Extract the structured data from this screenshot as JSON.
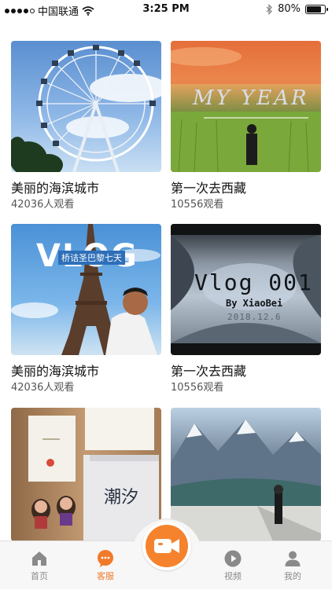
{
  "status_bar": {
    "carrier": "中国联通",
    "time": "3:25 PM",
    "battery_text": "80%",
    "battery_level": 0.8
  },
  "cards": [
    {
      "title": "美丽的海滨城市",
      "views": "42036人观看",
      "thumb_icon": "ferris-wheel-thumbnail"
    },
    {
      "title": "第一次去西藏",
      "views": "10556观看",
      "thumb_icon": "my-year-thumbnail",
      "overlay": "MY YEAR"
    },
    {
      "title": "美丽的海滨城市",
      "views": "42036人观看",
      "thumb_icon": "eiffel-tower-thumbnail",
      "overlay": "VLOG",
      "overlay_sub": "桥诘圣巴黎七天"
    },
    {
      "title": "第一次去西藏",
      "views": "10556观看",
      "thumb_icon": "vlog-001-thumbnail",
      "overlay": "Vlog 001",
      "overlay_by": "By XiaoBei",
      "overlay_date": "2018.12.6"
    },
    {
      "title": "",
      "views": "",
      "thumb_icon": "stationery-thumbnail",
      "overlay": "潮汐"
    },
    {
      "title": "",
      "views": "",
      "thumb_icon": "snow-mountain-thumbnail"
    }
  ],
  "tabbar": {
    "items": [
      {
        "label": "首页",
        "icon": "home-icon"
      },
      {
        "label": "客服",
        "icon": "chat-icon",
        "active": true
      },
      {
        "label": "",
        "icon": "video-camera-icon"
      },
      {
        "label": "视频",
        "icon": "play-icon"
      },
      {
        "label": "我的",
        "icon": "person-icon"
      }
    ],
    "accent": "#f5832e"
  }
}
